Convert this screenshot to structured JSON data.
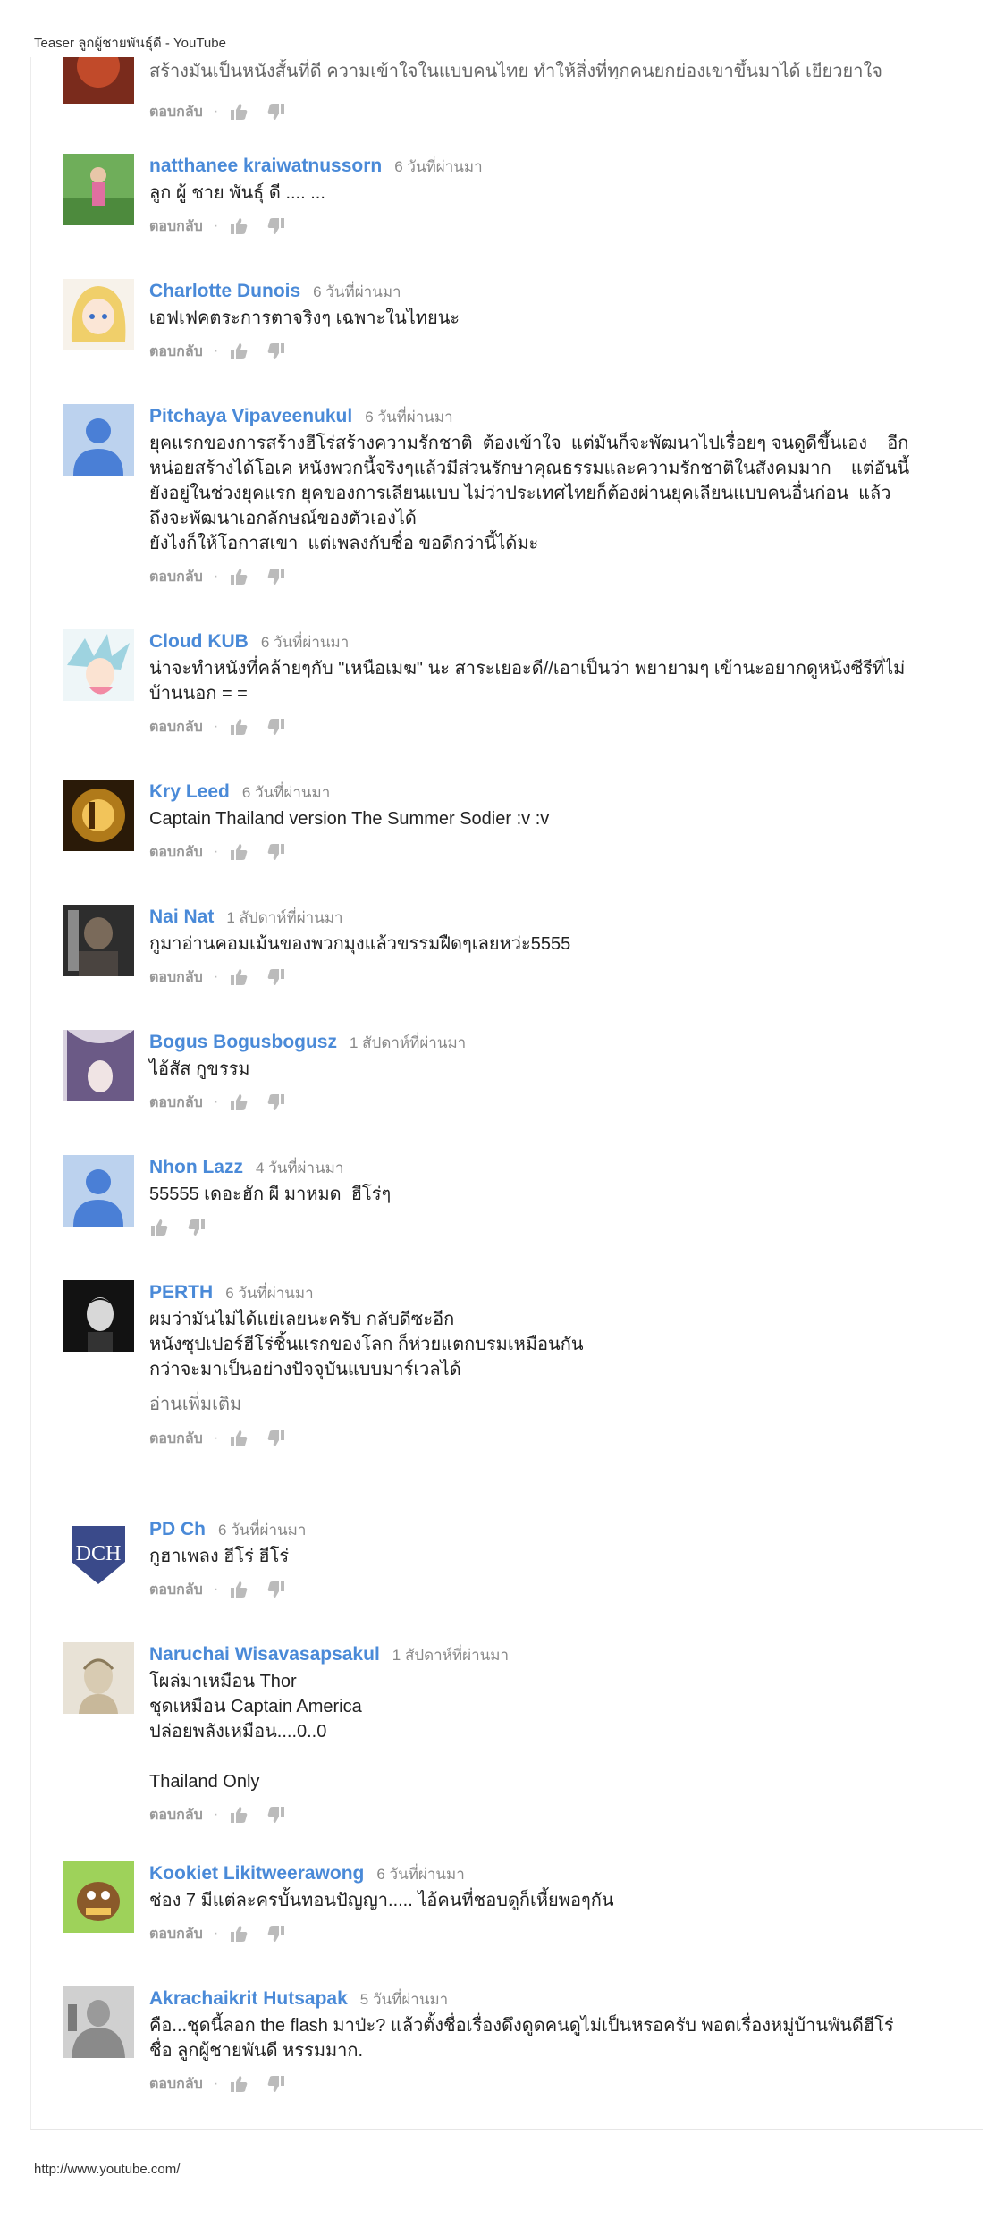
{
  "page": {
    "title": "Teaser ลูกผู้ชายพันธุ์ดี - YouTube",
    "footer_url": "http://www.youtube.com/"
  },
  "labels": {
    "reply": "ตอบกลับ",
    "separator": "·",
    "read_more": "อ่านเพิ่มเติม"
  },
  "top_comment": {
    "partial_text": "สร้างมันเป็นหนังสั้นที่ดี ความเข้าใจในแบบคนไทย ทำให้สิ่งที่ทุกคนยกย่องเขาขึ้นมาได้ เยียวยาใจ"
  },
  "comments": [
    {
      "author": "natthanee kraiwatnussorn",
      "time": "6 วันที่ผ่านมา",
      "lines": [
        "ลูก ผู้ ชาย พันธุ์ ดี .... ..."
      ],
      "avatar": "photo-green"
    },
    {
      "author": "Charlotte Dunois",
      "time": "6 วันที่ผ่านมา",
      "lines": [
        "เอฟเฟคตระการตาจริงๆ เฉพาะในไทยนะ"
      ],
      "avatar": "anime-blonde"
    },
    {
      "author": "Pitchaya Vipaveenukul",
      "time": "6 วันที่ผ่านมา",
      "lines": [
        "ยุคแรกของการสร้างฮีโร่สร้างความรักชาติ  ต้องเข้าใจ  แต่มันก็จะพัฒนาไปเรื่อยๆ จนดูดีขึ้นเอง    อีก",
        "หน่อยสร้างได้โอเค หนังพวกนี้จริงๆแล้วมีส่วนรักษาคุณธรรมและความรักชาติในสังคมมาก    แต่อันนี้",
        "ยังอยู่ในช่วงยุคแรก ยุคของการเลียนแบบ ไม่ว่าประเทศไทยก็ต้องผ่านยุคเลียนแบบคนอื่นก่อน  แล้ว",
        "ถึงจะพัฒนาเอกลักษณ์ของตัวเองได้",
        "ยังไงก็ให้โอกาสเขา  แต่เพลงกับชื่อ ขอดีกว่านี้ได้มะ"
      ],
      "avatar": "default"
    },
    {
      "author": "Cloud KUB",
      "time": "6 วันที่ผ่านมา",
      "lines": [
        "น่าจะทำหนังที่คล้ายๆกับ \"เหนือเมฆ\" นะ สาระเยอะดี//เอาเป็นว่า พยายามๆ เข้านะอยากดูหนังซีรีที่ไม่",
        "บ้านนอก = ="
      ],
      "avatar": "anime-cloud"
    },
    {
      "author": "Kry Leed",
      "time": "6 วันที่ผ่านมา",
      "lines": [
        "Captain Thailand version The Summer Sodier :v :v"
      ],
      "avatar": "gold-logo"
    },
    {
      "author": "Nai Nat",
      "time": "1 สัปดาห์ที่ผ่านมา",
      "lines": [
        "กูมาอ่านคอมเม้นของพวกมุงแล้วขรรมฝืดๆเลยหว่ะ5555"
      ],
      "avatar": "poster"
    },
    {
      "author": "Bogus Bogusbogusz",
      "time": "1 สัปดาห์ที่ผ่านมา",
      "lines": [
        "ไอ้สัส กูขรรม"
      ],
      "avatar": "purple-hair"
    },
    {
      "author": "Nhon Lazz",
      "time": "4 วันที่ผ่านมา",
      "lines": [
        "55555 เดอะฮัก ผี มาหมด  ฮีโร่ๆ"
      ],
      "avatar": "default",
      "no_reply": true
    },
    {
      "author": "PERTH",
      "time": "6 วันที่ผ่านมา",
      "lines": [
        "ผมว่ามันไม่ได้แย่เลยนะครับ กลับดีซะอีก",
        "หนังซุปเปอร์ฮีโร่ชิ้นแรกของโลก ก็ห่วยแตกบรมเหมือนกัน",
        "กว่าจะมาเป็นอย่างปัจจุบันแบบมาร์เวลได้"
      ],
      "avatar": "dark-portrait",
      "read_more": true
    },
    {
      "author": "PD Ch",
      "time": "6 วันที่ผ่านมา",
      "lines": [
        "กูฮาเพลง ฮีโร่ ฮีโร่"
      ],
      "avatar": "emblem"
    },
    {
      "author": "Naruchai Wisavasapsakul",
      "time": "1 สัปดาห์ที่ผ่านมา",
      "lines": [
        "โผล่มาเหมือน Thor",
        "ชุดเหมือน Captain America",
        "ปล่อยพลังเหมือน....0..0",
        "",
        "Thailand Only"
      ],
      "avatar": "sketch"
    },
    {
      "author": "Kookiet Likitweerawong",
      "time": "6 วันที่ผ่านมา",
      "lines": [
        "ช่อง 7 มีแต่ละครบั้นทอนปัญญา..... ไอ้คนที่ชอบดูก็เหี้ยพอๆกัน"
      ],
      "avatar": "cartoon"
    },
    {
      "author": "Akrachaikrit Hutsapak",
      "time": "5 วันที่ผ่านมา",
      "lines": [
        "คือ...ชุดนี้ลอก the flash มาป่ะ? แล้วตั้งชื่อเรื่องดึงดูดคนดูไม่เป็นหรอครับ พอตเรื่องหมู่บ้านพันดีฮีโร่",
        "ชื่อ ลูกผู้ชายพันดี หรรมมาก."
      ],
      "avatar": "statue"
    }
  ],
  "colors": {
    "author": "#4a8ad8",
    "time": "#888888",
    "action": "#999999",
    "default_avatar_bg": "#bcd2ee",
    "default_avatar_fg": "#4a7fd6"
  }
}
